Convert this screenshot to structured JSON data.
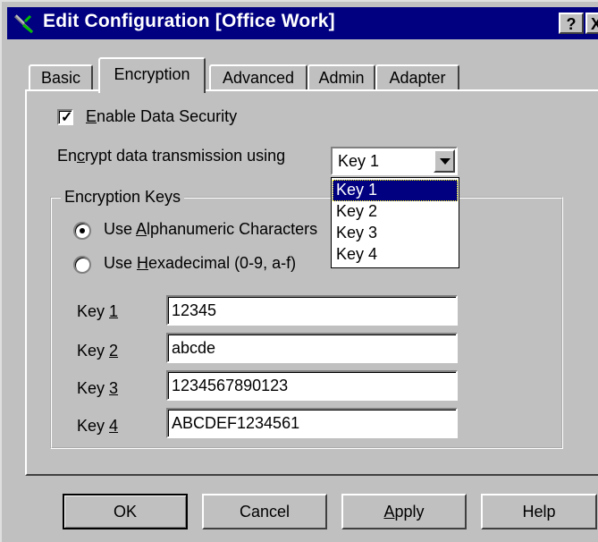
{
  "window": {
    "title": "Edit Configuration [Office Work]",
    "help_button": "?",
    "close_button": "X"
  },
  "tabs": [
    {
      "label": "Basic",
      "active": false
    },
    {
      "label": "Encryption",
      "active": true
    },
    {
      "label": "Advanced",
      "active": false
    },
    {
      "label": "Admin",
      "active": false
    },
    {
      "label": "Adapter",
      "active": false
    }
  ],
  "encryption": {
    "enable_security": {
      "label_mnemonic": "E",
      "label_rest": "nable Data Security",
      "checked": true
    },
    "encrypt_using": {
      "label_pre": "En",
      "label_mnemonic": "c",
      "label_post": "rypt data transmission using",
      "selected": "Key 1"
    },
    "dropdown_options": [
      "Key 1",
      "Key 2",
      "Key 3",
      "Key 4"
    ],
    "group_title": "Encryption Keys",
    "radio_alpha": {
      "pre": "Use ",
      "mnemonic": "A",
      "post": "lphanumeric Characters",
      "selected": true
    },
    "radio_hex": {
      "pre": "Use ",
      "mnemonic": "H",
      "post": "exadecimal (0-9, a-f)",
      "selected": false
    },
    "keys": [
      {
        "label_pre": "Key ",
        "label_mnemonic": "1",
        "value": "12345"
      },
      {
        "label_pre": "Key ",
        "label_mnemonic": "2",
        "value": "abcde"
      },
      {
        "label_pre": "Key ",
        "label_mnemonic": "3",
        "value": "1234567890123"
      },
      {
        "label_pre": "Key ",
        "label_mnemonic": "4",
        "value": "ABCDEF1234561"
      }
    ]
  },
  "buttons": {
    "ok": "OK",
    "cancel": "Cancel",
    "apply_mnemonic": "A",
    "apply_rest": "pply",
    "help": "Help"
  },
  "colors": {
    "face": "#c0c0c0",
    "titlebar": "#000080",
    "selection": "#000080"
  }
}
